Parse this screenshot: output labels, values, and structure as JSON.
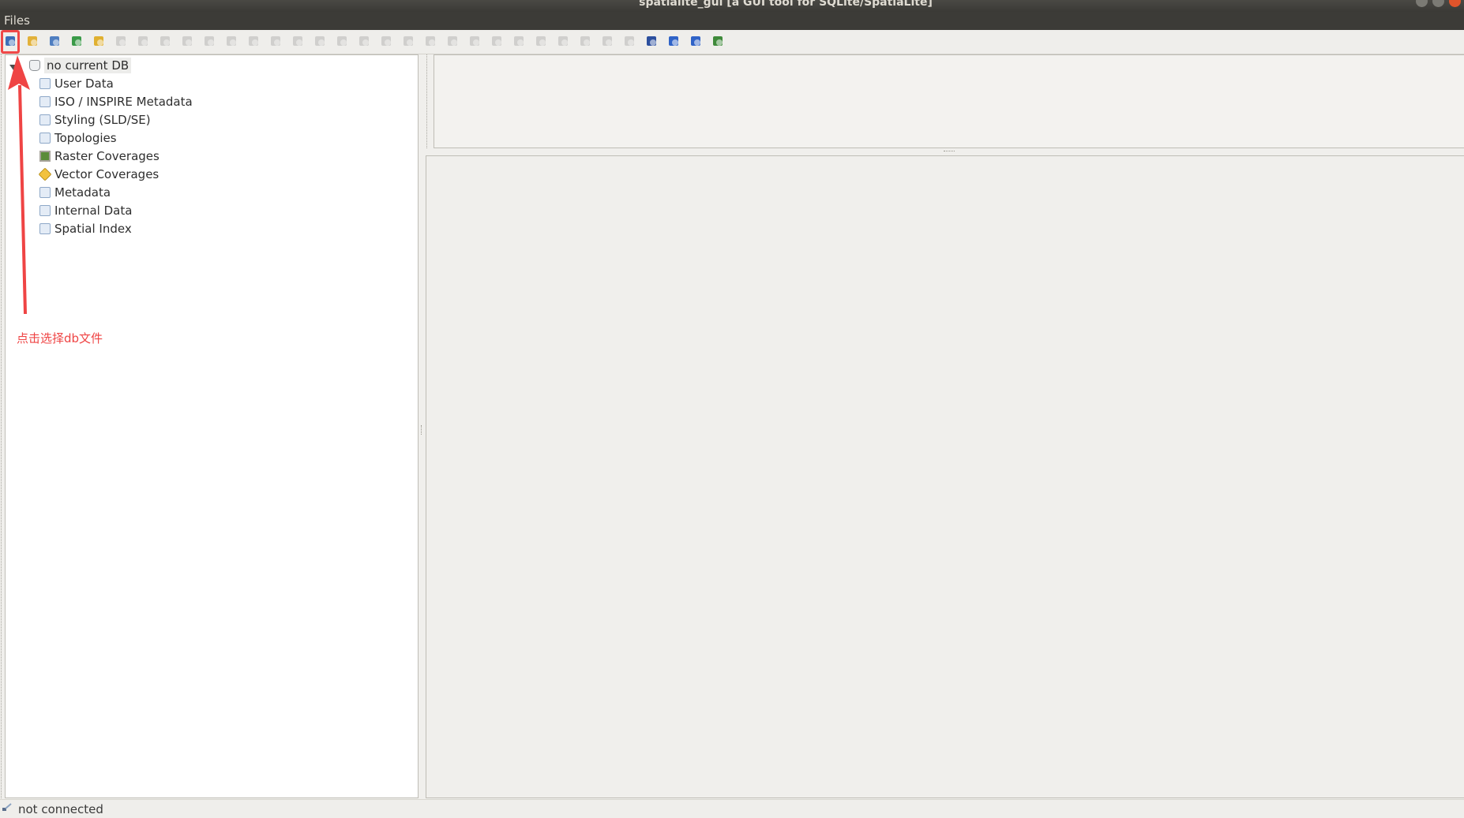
{
  "window": {
    "title": "spatialite_gui      [a GUI tool for SQLite/SpatiaLite]"
  },
  "menubar": {
    "items": [
      "Files"
    ]
  },
  "toolbar": {
    "buttons": [
      {
        "name": "connect-db-button",
        "icon": "connect-db-icon",
        "enabled": true,
        "color": "#3d6fb8"
      },
      {
        "name": "create-db-button",
        "icon": "new-db-icon",
        "enabled": true,
        "color": "#e2b13a"
      },
      {
        "name": "memory-db-button",
        "icon": "memory-db-icon",
        "enabled": true,
        "color": "#4f7ec0"
      },
      {
        "name": "load-memory-button",
        "icon": "load-icon",
        "enabled": true,
        "color": "#3a9a48"
      },
      {
        "name": "attach-db-button",
        "icon": "attach-icon",
        "enabled": true,
        "color": "#e0b030"
      }
    ],
    "disabled_count": 24,
    "trailing_buttons": [
      {
        "name": "charset-button",
        "icon": "charset-icon",
        "enabled": true,
        "color": "#2c4f9e"
      },
      {
        "name": "help-button",
        "icon": "help-icon",
        "enabled": true,
        "color": "#2f63c7"
      },
      {
        "name": "about-button",
        "icon": "about-icon",
        "enabled": true,
        "color": "#2f63c7"
      },
      {
        "name": "exit-button",
        "icon": "exit-icon",
        "enabled": true,
        "color": "#3f8a3a"
      }
    ]
  },
  "tree": {
    "root": "no current DB",
    "children": [
      {
        "label": "User Data",
        "icon": "folder-icon"
      },
      {
        "label": "ISO / INSPIRE Metadata",
        "icon": "folder-icon"
      },
      {
        "label": "Styling (SLD/SE)",
        "icon": "folder-icon"
      },
      {
        "label": "Topologies",
        "icon": "folder-icon"
      },
      {
        "label": "Raster Coverages",
        "icon": "raster-icon"
      },
      {
        "label": "Vector Coverages",
        "icon": "vector-icon"
      },
      {
        "label": "Metadata",
        "icon": "folder-icon"
      },
      {
        "label": "Internal Data",
        "icon": "folder-icon"
      },
      {
        "label": "Spatial Index",
        "icon": "folder-icon"
      }
    ]
  },
  "annotation": {
    "text": "点击选择db文件",
    "color": "#ef4444"
  },
  "statusbar": {
    "text": "not connected"
  }
}
